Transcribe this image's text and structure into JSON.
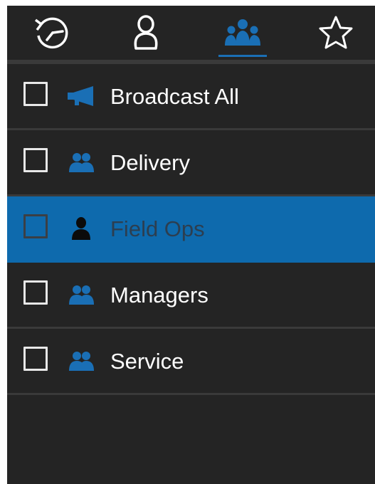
{
  "tabs": [
    {
      "icon": "history-icon"
    },
    {
      "icon": "contact-icon"
    },
    {
      "icon": "groups-icon",
      "active": true
    },
    {
      "icon": "star-icon"
    }
  ],
  "groups": [
    {
      "label": "Broadcast All",
      "icon": "megaphone-icon",
      "selected": false
    },
    {
      "label": "Delivery",
      "icon": "group-icon",
      "selected": false
    },
    {
      "label": "Field Ops",
      "icon": "person-icon",
      "selected": true
    },
    {
      "label": "Managers",
      "icon": "group-icon",
      "selected": false
    },
    {
      "label": "Service",
      "icon": "group-icon",
      "selected": false
    }
  ],
  "colors": {
    "background": "#242424",
    "accent": "#1a6fb5",
    "selected_row": "#0e6aad",
    "divider": "#3a3a3a"
  }
}
